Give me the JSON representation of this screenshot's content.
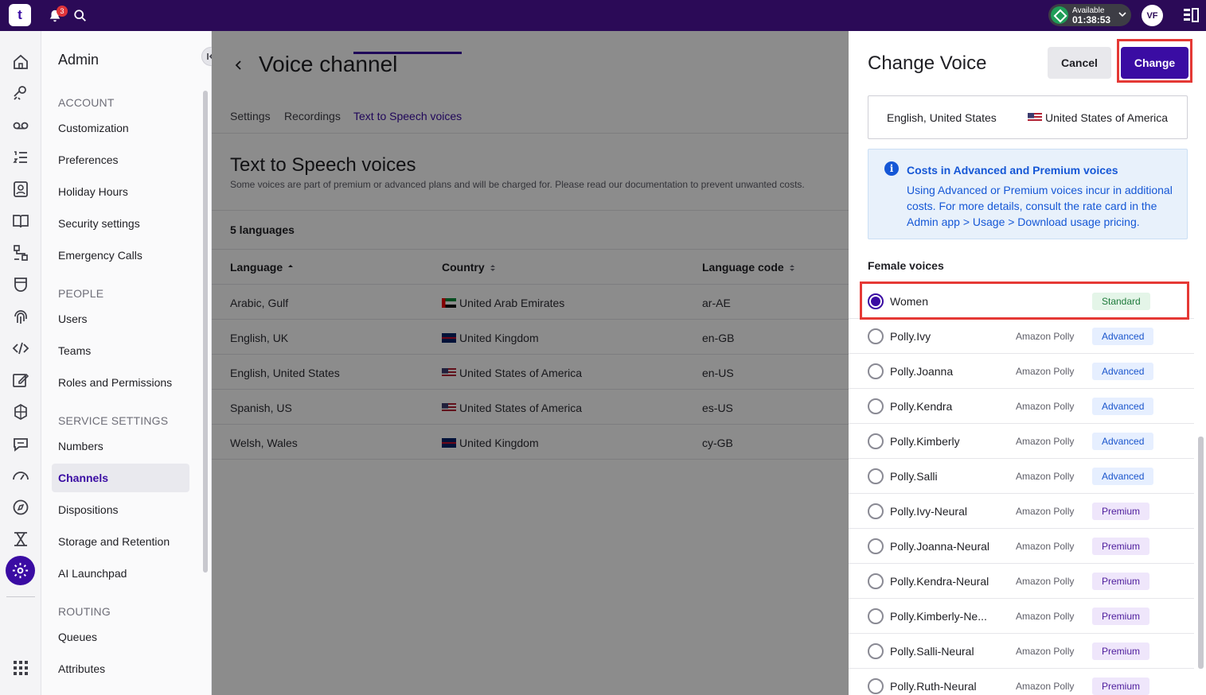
{
  "topbar": {
    "logo": "t",
    "notifications_count": "3",
    "status_label": "Available",
    "status_time": "01:38:53",
    "avatar_initials": "VF"
  },
  "sidebar": {
    "title": "Admin",
    "sections": [
      {
        "heading": "ACCOUNT",
        "items": [
          "Customization",
          "Preferences",
          "Holiday Hours",
          "Security settings",
          "Emergency Calls"
        ]
      },
      {
        "heading": "PEOPLE",
        "items": [
          "Users",
          "Teams",
          "Roles and Permissions"
        ]
      },
      {
        "heading": "SERVICE SETTINGS",
        "items": [
          "Numbers",
          "Channels",
          "Dispositions",
          "Storage and Retention",
          "AI Launchpad"
        ]
      },
      {
        "heading": "ROUTING",
        "items": [
          "Queues",
          "Attributes"
        ]
      }
    ],
    "active_item": "Channels"
  },
  "main": {
    "title": "Voice channel",
    "tabs": [
      "Settings",
      "Recordings",
      "Text to Speech voices"
    ],
    "active_tab": "Text to Speech voices",
    "section_title": "Text to Speech voices",
    "section_subtitle": "Some voices are part of premium or advanced plans and will be charged for. Please read our documentation to prevent unwanted costs.",
    "languages_count": "5 languages",
    "table": {
      "headers": [
        "Language",
        "Country",
        "Language code"
      ],
      "rows": [
        {
          "language": "Arabic, Gulf",
          "country": "United Arab Emirates",
          "flag": "uae-flag",
          "code": "ar-AE"
        },
        {
          "language": "English, UK",
          "country": "United Kingdom",
          "flag": "uk-flag",
          "code": "en-GB"
        },
        {
          "language": "English, United States",
          "country": "United States of America",
          "flag": "us-flag",
          "code": "en-US"
        },
        {
          "language": "Spanish, US",
          "country": "United States of America",
          "flag": "us-flag",
          "code": "es-US"
        },
        {
          "language": "Welsh, Wales",
          "country": "United Kingdom",
          "flag": "uk-flag",
          "code": "cy-GB"
        }
      ]
    }
  },
  "panel": {
    "title": "Change Voice",
    "cancel_label": "Cancel",
    "change_label": "Change",
    "language": "English, United States",
    "country": "United States of America",
    "info_title": "Costs in Advanced and Premium voices",
    "info_text": "Using Advanced or Premium voices incur in additional costs. For more details, consult the rate card in the Admin app > Usage > Download usage pricing.",
    "list_label": "Female voices",
    "voices": [
      {
        "name": "Women",
        "provider": "",
        "tier": "Standard",
        "selected": true
      },
      {
        "name": "Polly.Ivy",
        "provider": "Amazon Polly",
        "tier": "Advanced",
        "selected": false
      },
      {
        "name": "Polly.Joanna",
        "provider": "Amazon Polly",
        "tier": "Advanced",
        "selected": false
      },
      {
        "name": "Polly.Kendra",
        "provider": "Amazon Polly",
        "tier": "Advanced",
        "selected": false
      },
      {
        "name": "Polly.Kimberly",
        "provider": "Amazon Polly",
        "tier": "Advanced",
        "selected": false
      },
      {
        "name": "Polly.Salli",
        "provider": "Amazon Polly",
        "tier": "Advanced",
        "selected": false
      },
      {
        "name": "Polly.Ivy-Neural",
        "provider": "Amazon Polly",
        "tier": "Premium",
        "selected": false
      },
      {
        "name": "Polly.Joanna-Neural",
        "provider": "Amazon Polly",
        "tier": "Premium",
        "selected": false
      },
      {
        "name": "Polly.Kendra-Neural",
        "provider": "Amazon Polly",
        "tier": "Premium",
        "selected": false
      },
      {
        "name": "Polly.Kimberly-Ne...",
        "provider": "Amazon Polly",
        "tier": "Premium",
        "selected": false
      },
      {
        "name": "Polly.Salli-Neural",
        "provider": "Amazon Polly",
        "tier": "Premium",
        "selected": false
      },
      {
        "name": "Polly.Ruth-Neural",
        "provider": "Amazon Polly",
        "tier": "Premium",
        "selected": false
      }
    ]
  },
  "colors": {
    "brand": "#2b0a57",
    "accent": "#3a0ca3",
    "highlight_box": "#e53935"
  }
}
